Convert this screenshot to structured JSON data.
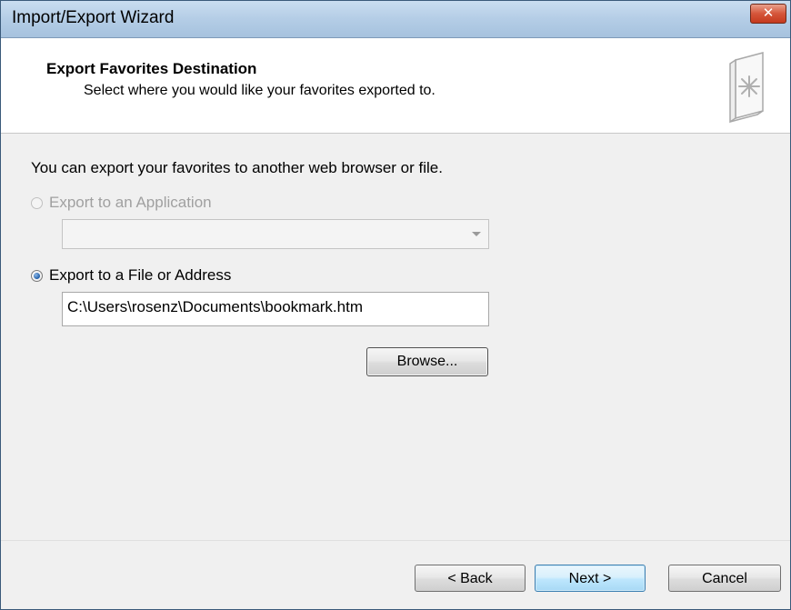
{
  "window": {
    "title": "Import/Export Wizard",
    "close_label": "✕"
  },
  "header": {
    "title": "Export Favorites Destination",
    "subtitle": "Select where you would like your favorites exported to."
  },
  "body": {
    "description": "You can export your favorites to another web browser or file.",
    "option_application": {
      "label": "Export to an Application",
      "selected": false,
      "enabled": false,
      "dropdown_value": ""
    },
    "option_file": {
      "label": "Export to a File or Address",
      "selected": true,
      "enabled": true,
      "path_value": "C:\\Users\\rosenz\\Documents\\bookmark.htm"
    },
    "browse_label": "Browse..."
  },
  "footer": {
    "back_label": "< Back",
    "next_label": "Next >",
    "cancel_label": "Cancel"
  },
  "icons": {
    "header_icon": "favorites-book-icon"
  }
}
